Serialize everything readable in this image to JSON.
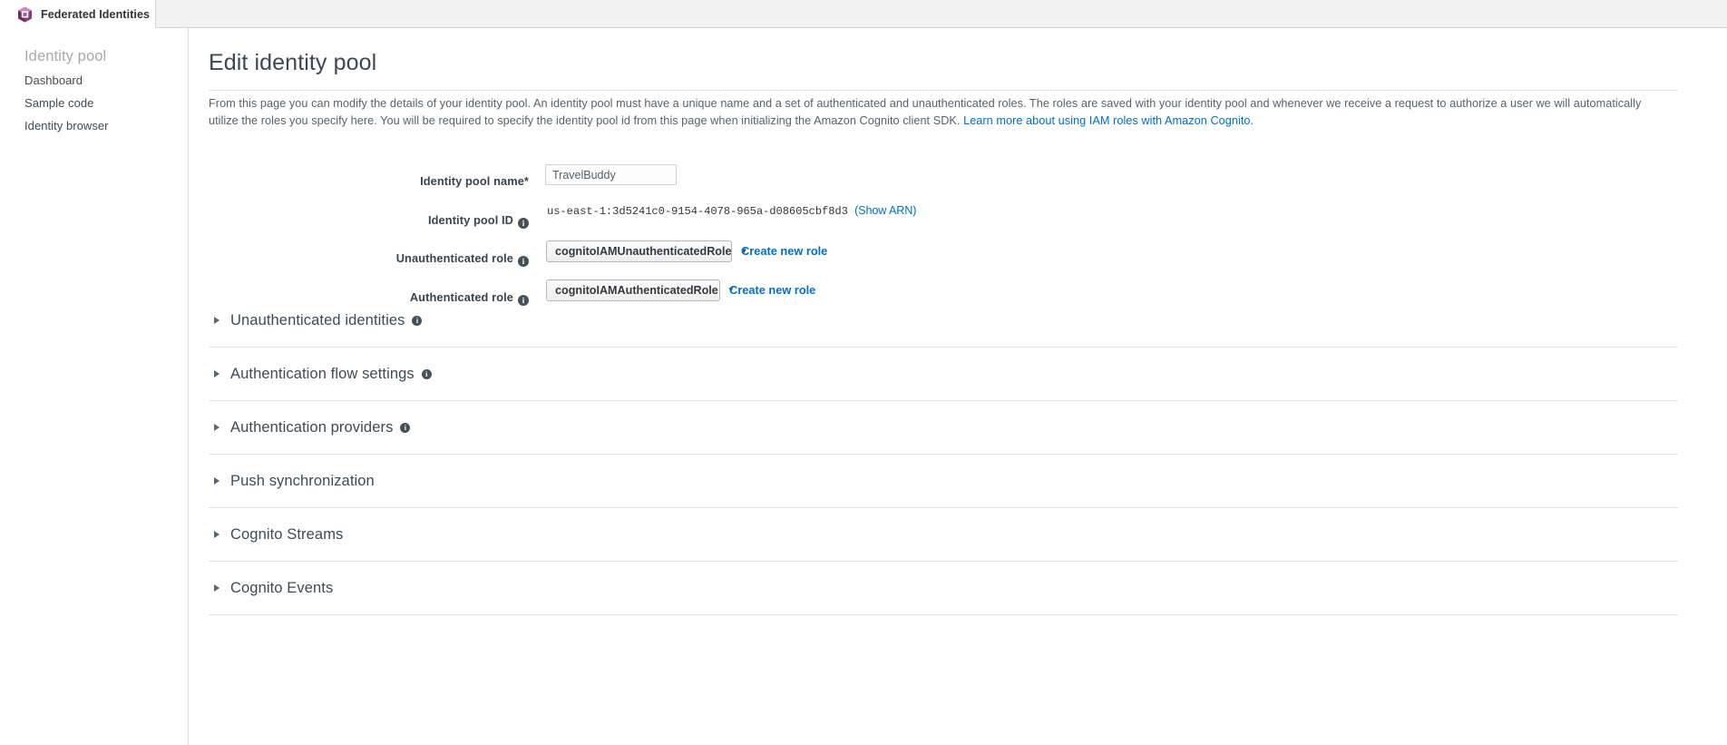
{
  "topbar": {
    "app_title": "Federated Identities",
    "logo_icon": "cognito-hexagon-logo-icon",
    "logo_colors": {
      "light": "#c98fbb",
      "mid": "#a85f95",
      "dark": "#8c3d7a",
      "deep": "#6e2d60"
    }
  },
  "sidebar": {
    "heading": "Identity pool",
    "items": [
      {
        "label": "Dashboard"
      },
      {
        "label": "Sample code"
      },
      {
        "label": "Identity browser"
      }
    ]
  },
  "main": {
    "title": "Edit identity pool",
    "description_part1": "From this page you can modify the details of your identity pool. An identity pool must have a unique name and a set of authenticated and unauthenticated roles. The roles are saved with your identity pool and whenever we receive a request to authorize a user we will automatically utilize the roles you specify here. You will be required to specify the identity pool id from this page when initializing the Amazon Cognito client SDK. ",
    "description_link": "Learn more about using IAM roles with Amazon Cognito.",
    "link_color": "#0070c9"
  },
  "form": {
    "pool_name": {
      "label": "Identity pool name*",
      "value": "TravelBuddy",
      "placeholder": "Identity pool name"
    },
    "pool_id": {
      "label": "Identity pool ID",
      "info_icon": "info-icon",
      "value": "us-east-1:3d5241c0-9154-4078-965a-d08605cbf8d3",
      "show_arn": "(Show ARN)"
    },
    "unauth_role": {
      "label": "Unauthenticated role",
      "info_icon": "info-icon",
      "selected": "cognitoIAMUnauthenticatedRole",
      "caret_icon": "chevron-down-icon",
      "create_link": "Create new role"
    },
    "auth_role": {
      "label": "Authenticated role",
      "info_icon": "info-icon",
      "selected": "cognitoIAMAuthenticatedRole",
      "caret_icon": "chevron-down-icon",
      "create_link": "Create new role"
    }
  },
  "sections": [
    {
      "label": "Unauthenticated identities",
      "has_info": true,
      "arrow_icon": "triangle-right-icon"
    },
    {
      "label": "Authentication flow settings",
      "has_info": true,
      "arrow_icon": "triangle-right-icon"
    },
    {
      "label": "Authentication providers",
      "has_info": true,
      "arrow_icon": "triangle-right-icon"
    },
    {
      "label": "Push synchronization",
      "has_info": false,
      "arrow_icon": "triangle-right-icon"
    },
    {
      "label": "Cognito Streams",
      "has_info": false,
      "arrow_icon": "triangle-right-icon"
    },
    {
      "label": "Cognito Events",
      "has_info": false,
      "arrow_icon": "triangle-right-icon"
    }
  ],
  "info_symbol": "i"
}
